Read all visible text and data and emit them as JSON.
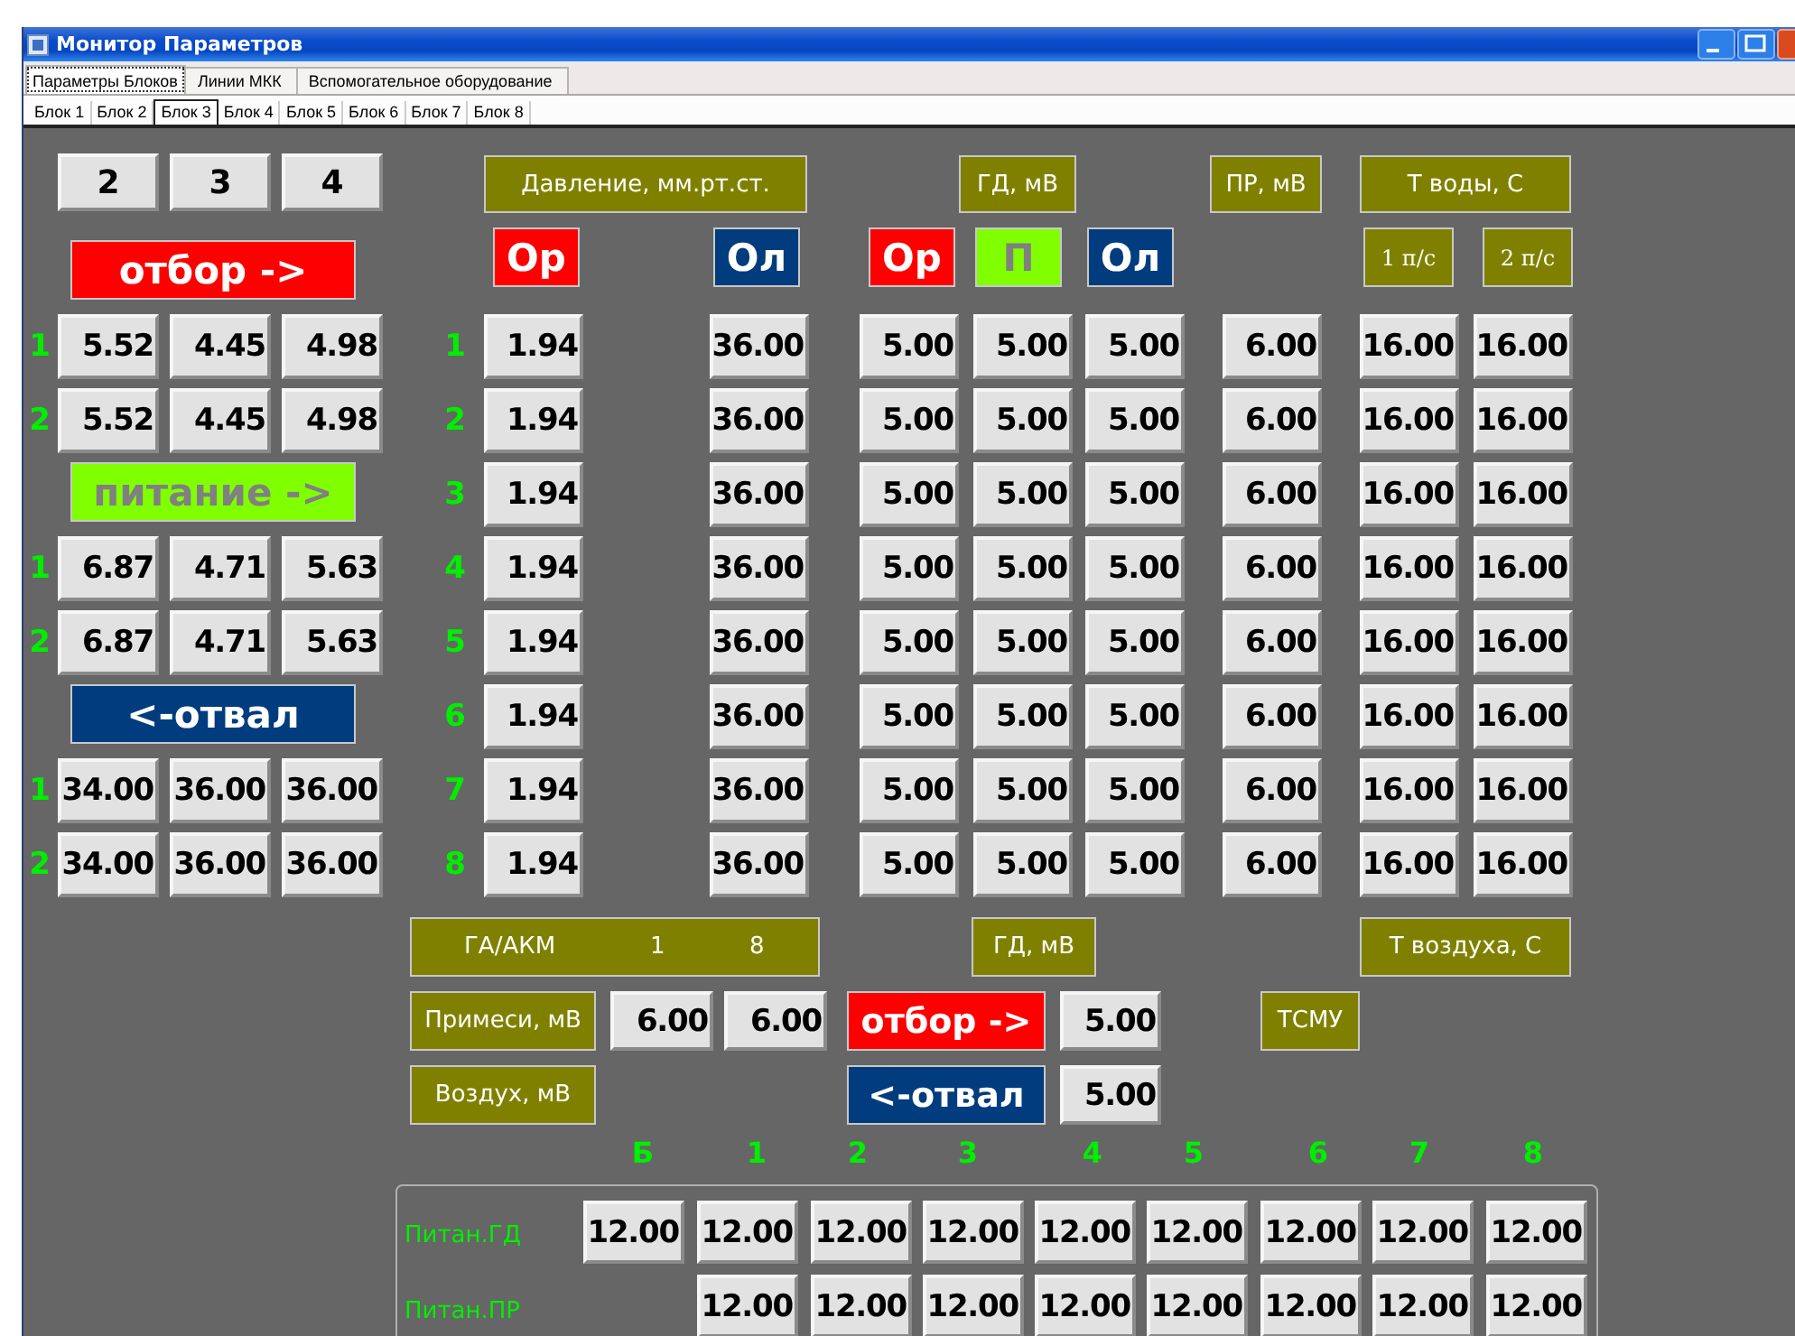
{
  "window": {
    "title": "Монитор Параметров"
  },
  "tabs": [
    {
      "label": "Параметры Блоков",
      "selected": true
    },
    {
      "label": "Линии МКК",
      "selected": false
    },
    {
      "label": "Вспомогательное оборудование",
      "selected": false
    }
  ],
  "block_tabs": [
    {
      "label": "Блок 1",
      "selected": false
    },
    {
      "label": "Блок 2",
      "selected": false
    },
    {
      "label": "Блок 3",
      "selected": true
    },
    {
      "label": "Блок 4",
      "selected": false
    },
    {
      "label": "Блок 5",
      "selected": false
    },
    {
      "label": "Блок 6",
      "selected": false
    },
    {
      "label": "Блок 7",
      "selected": false
    },
    {
      "label": "Блок 8",
      "selected": false
    }
  ],
  "block_buttons": [
    "2",
    "3",
    "4"
  ],
  "left_sections": [
    {
      "label": "отбор ->",
      "kind": "otbor",
      "rows": [
        {
          "label": "1",
          "values": [
            "5.52",
            "4.45",
            "4.98"
          ]
        },
        {
          "label": "2",
          "values": [
            "5.52",
            "4.45",
            "4.98"
          ]
        }
      ]
    },
    {
      "label": "питание ->",
      "kind": "pitanie",
      "rows": [
        {
          "label": "1",
          "values": [
            "6.87",
            "4.71",
            "5.63"
          ]
        },
        {
          "label": "2",
          "values": [
            "6.87",
            "4.71",
            "5.63"
          ]
        }
      ]
    },
    {
      "label": "<-отвал",
      "kind": "otval",
      "rows": [
        {
          "label": "1",
          "values": [
            "34.00",
            "36.00",
            "36.00"
          ]
        },
        {
          "label": "2",
          "values": [
            "34.00",
            "36.00",
            "36.00"
          ]
        }
      ]
    }
  ],
  "pressure": {
    "title": "Давление, мм.рт.ст.",
    "markers": [
      {
        "label": "Ор",
        "kind": "otbor"
      },
      {
        "label": "Ол",
        "kind": "otval"
      }
    ],
    "rows": [
      {
        "label": "1",
        "values": [
          "1.94",
          "36.00"
        ]
      },
      {
        "label": "2",
        "values": [
          "1.94",
          "36.00"
        ]
      },
      {
        "label": "3",
        "values": [
          "1.94",
          "36.00"
        ]
      },
      {
        "label": "4",
        "values": [
          "1.94",
          "36.00"
        ]
      },
      {
        "label": "5",
        "values": [
          "1.94",
          "36.00"
        ]
      },
      {
        "label": "6",
        "values": [
          "1.94",
          "36.00"
        ]
      },
      {
        "label": "7",
        "values": [
          "1.94",
          "36.00"
        ]
      },
      {
        "label": "8",
        "values": [
          "1.94",
          "36.00"
        ]
      }
    ]
  },
  "gd": {
    "title": "ГД, мВ",
    "markers": [
      {
        "label": "Ор",
        "kind": "otbor"
      },
      {
        "label": "П",
        "kind": "pitanie"
      },
      {
        "label": "Ол",
        "kind": "otval"
      }
    ],
    "rows": [
      [
        "5.00",
        "5.00",
        "5.00"
      ],
      [
        "5.00",
        "5.00",
        "5.00"
      ],
      [
        "5.00",
        "5.00",
        "5.00"
      ],
      [
        "5.00",
        "5.00",
        "5.00"
      ],
      [
        "5.00",
        "5.00",
        "5.00"
      ],
      [
        "5.00",
        "5.00",
        "5.00"
      ],
      [
        "5.00",
        "5.00",
        "5.00"
      ],
      [
        "5.00",
        "5.00",
        "5.00"
      ]
    ]
  },
  "pr": {
    "title": "ПР, мВ",
    "rows": [
      "6.00",
      "6.00",
      "6.00",
      "6.00",
      "6.00",
      "6.00",
      "6.00",
      "6.00"
    ]
  },
  "water": {
    "title": "Т воды, С",
    "subheaders": [
      "1 п/с",
      "2 п/с"
    ],
    "rows": [
      [
        "16.00",
        "16.00"
      ],
      [
        "16.00",
        "16.00"
      ],
      [
        "16.00",
        "16.00"
      ],
      [
        "16.00",
        "16.00"
      ],
      [
        "16.00",
        "16.00"
      ],
      [
        "16.00",
        "16.00"
      ],
      [
        "16.00",
        "16.00"
      ],
      [
        "16.00",
        "16.00"
      ]
    ]
  },
  "ga_akm": {
    "title": "ГА/АКМ",
    "column_1": "1",
    "column_2": "8"
  },
  "impurities": {
    "label": "Примеси, мВ",
    "values": [
      "6.00",
      "6.00"
    ]
  },
  "air": {
    "label": "Воздух, мВ"
  },
  "gd_bottom": {
    "title": "ГД, мВ",
    "rows": [
      {
        "label": "отбор ->",
        "kind": "otbor",
        "value": "5.00"
      },
      {
        "label": "<-отвал",
        "kind": "otval",
        "value": "5.00"
      }
    ]
  },
  "air_temp": {
    "title": "Т воздуха, С",
    "sensor": "ТСМУ"
  },
  "power": {
    "row_labels": [
      "Питан.ГД",
      "Питан.ПР"
    ],
    "columns": [
      {
        "label": "Б",
        "values": [
          "12.00"
        ]
      },
      {
        "label": "1",
        "values": [
          "12.00",
          "12.00"
        ]
      },
      {
        "label": "2",
        "values": [
          "12.00",
          "12.00"
        ]
      },
      {
        "label": "3",
        "values": [
          "12.00",
          "12.00"
        ]
      },
      {
        "label": "4",
        "values": [
          "12.00",
          "12.00"
        ]
      },
      {
        "label": "5",
        "values": [
          "12.00",
          "12.00"
        ]
      },
      {
        "label": "6",
        "values": [
          "12.00",
          "12.00"
        ]
      },
      {
        "label": "7",
        "values": [
          "12.00",
          "12.00"
        ]
      },
      {
        "label": "8",
        "values": [
          "12.00",
          "12.00"
        ]
      }
    ]
  }
}
